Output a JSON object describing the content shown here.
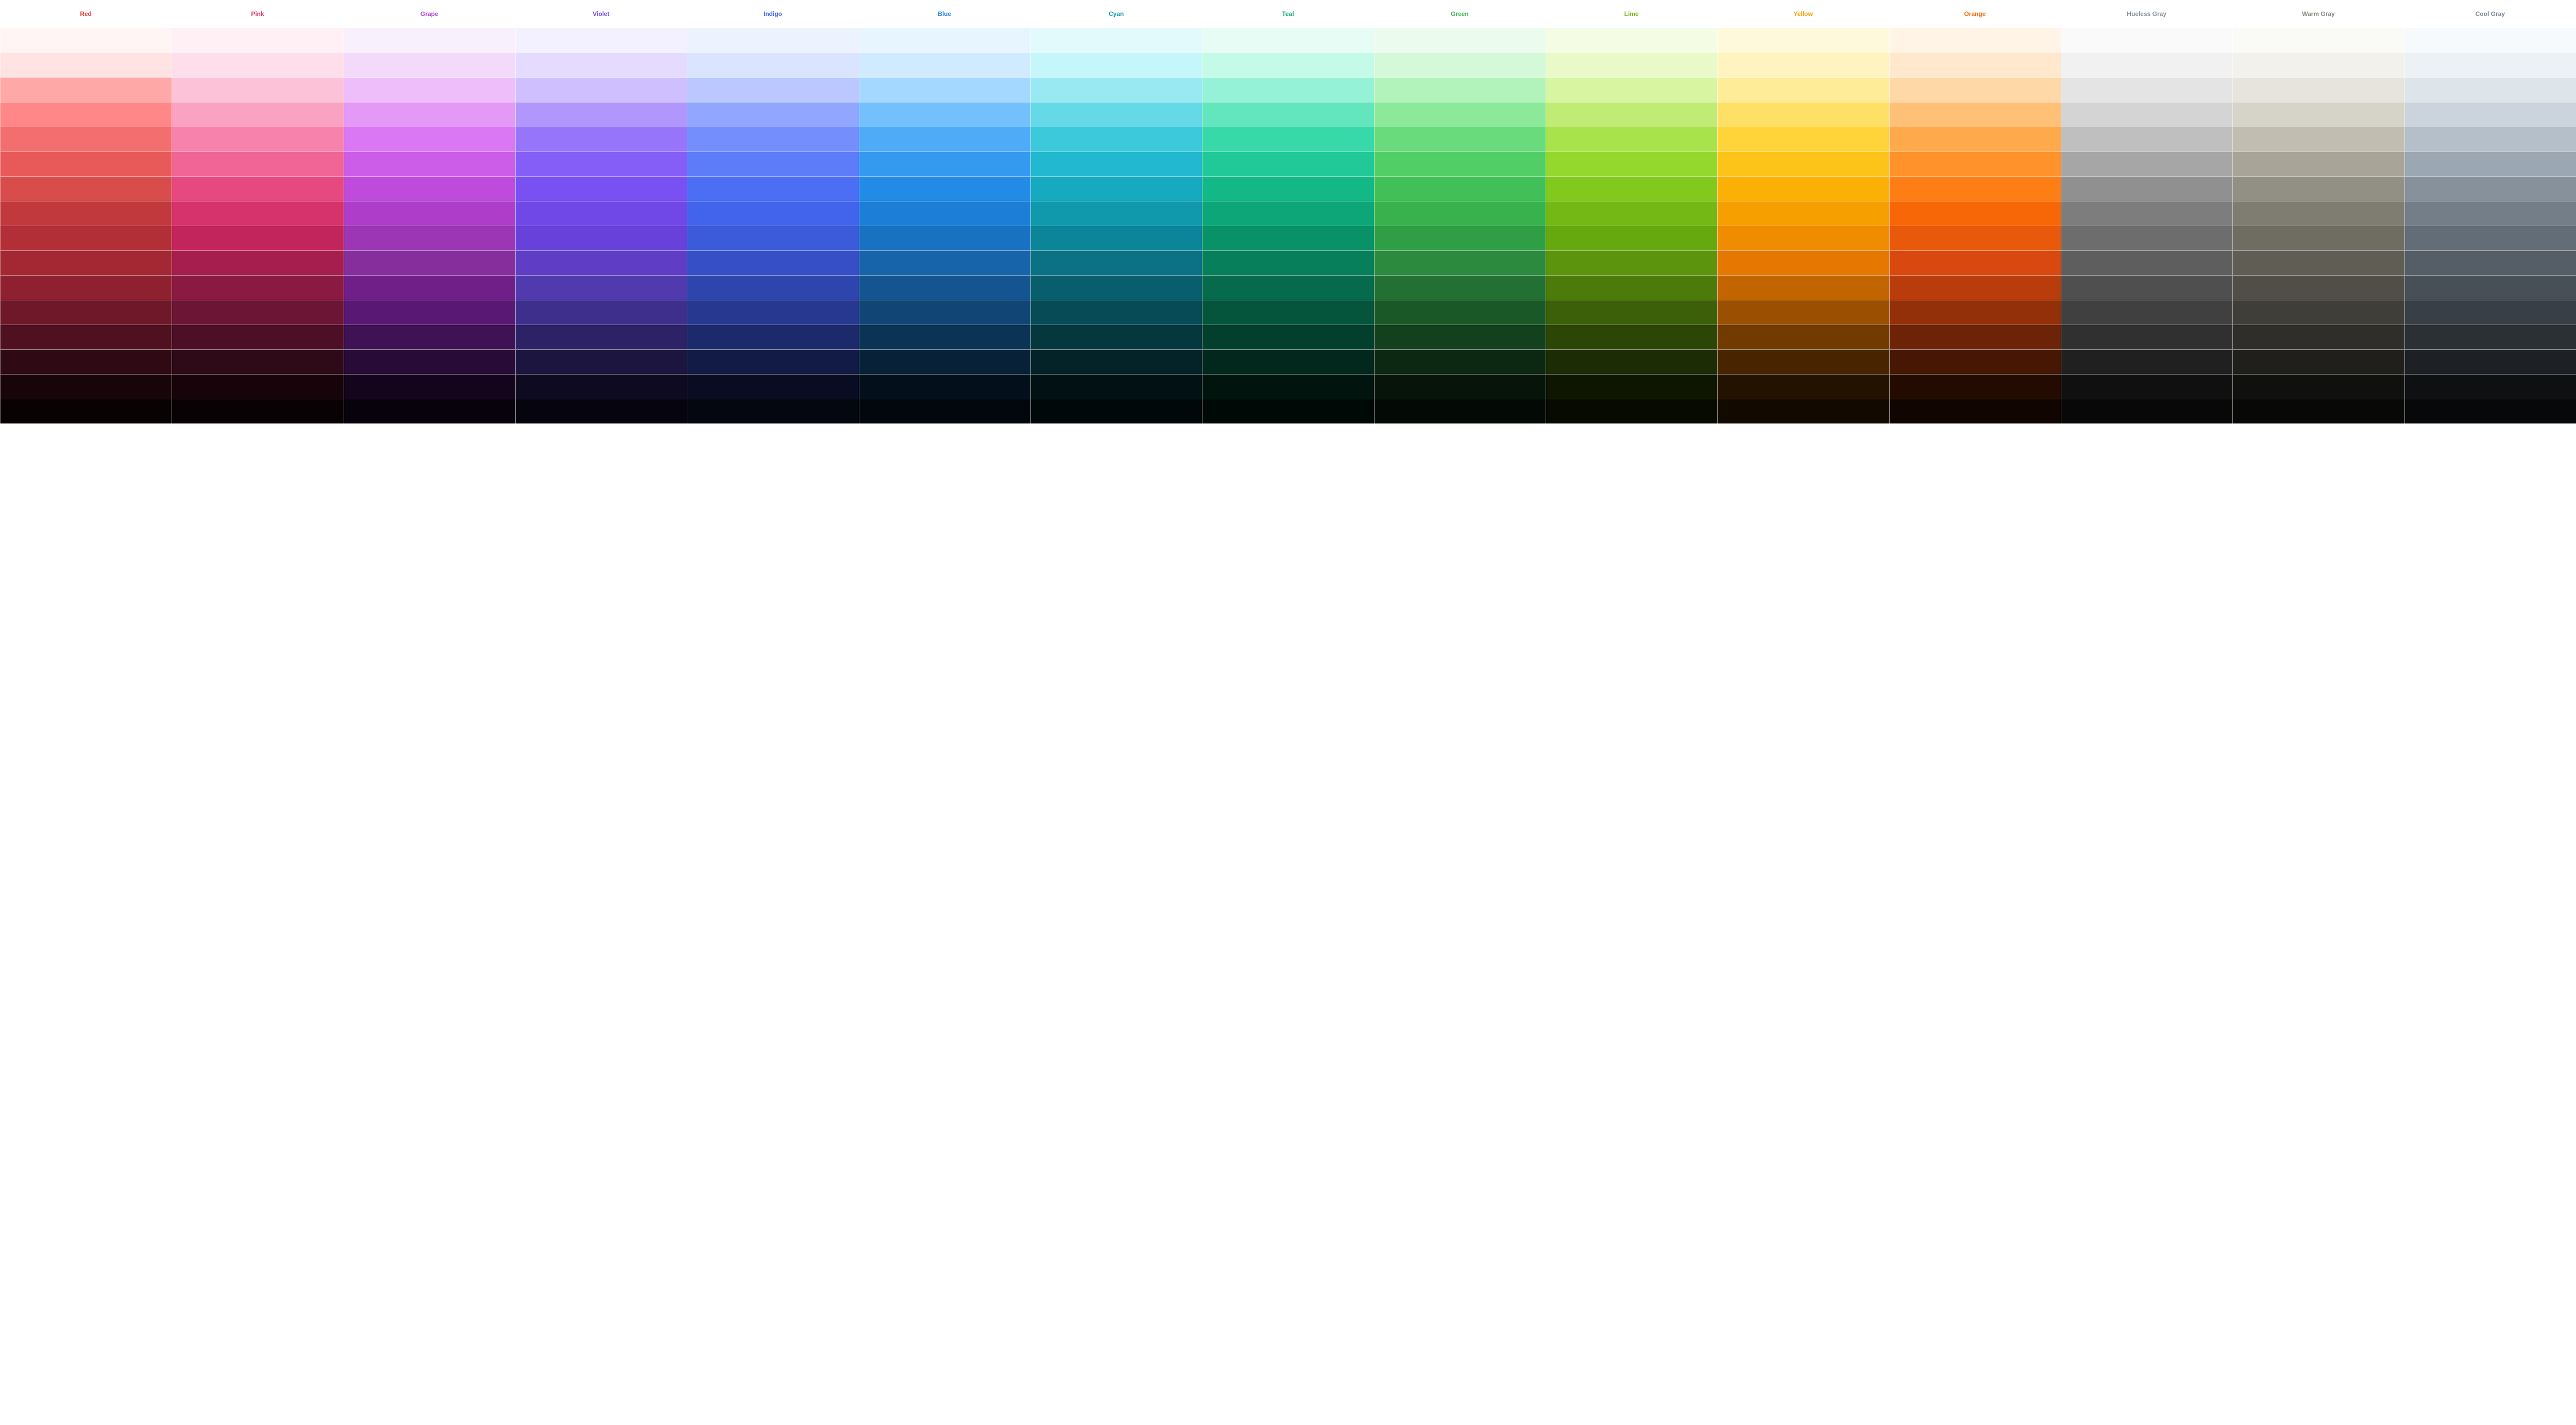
{
  "palette": {
    "columns": [
      {
        "name": "Red",
        "headerColor": "#e03131",
        "swatches": [
          "#fff5f5",
          "#ffe3e3",
          "#ffa8a8",
          "#ff8787",
          "#f36e6e",
          "#e85a5a",
          "#d94c4c",
          "#c1383d",
          "#b32f37",
          "#a42734",
          "#8f2030",
          "#6f182a",
          "#4f1020",
          "#2f0a14",
          "#18050a",
          "#080203"
        ]
      },
      {
        "name": "Pink",
        "headerColor": "#d6336c",
        "swatches": [
          "#fff0f6",
          "#ffdeeb",
          "#fcc2d7",
          "#faa2c1",
          "#f783ac",
          "#f06595",
          "#e64980",
          "#d6336c",
          "#c2255c",
          "#a61e4d",
          "#8a1a42",
          "#6c1535",
          "#4c0f26",
          "#2e0917",
          "#17040b",
          "#080204"
        ]
      },
      {
        "name": "Grape",
        "headerColor": "#ae3ec9",
        "swatches": [
          "#f8f0fc",
          "#f3d9fa",
          "#eebefa",
          "#e599f7",
          "#da77f2",
          "#cc5de8",
          "#be4bdb",
          "#ae3ec9",
          "#9c36b5",
          "#862e9c",
          "#701f89",
          "#581873",
          "#3f1155",
          "#280b37",
          "#14051c",
          "#08020c"
        ]
      },
      {
        "name": "Violet",
        "headerColor": "#7048e8",
        "swatches": [
          "#f3f0ff",
          "#e5dbff",
          "#d0bfff",
          "#b197fc",
          "#9775fa",
          "#845ef7",
          "#7950f2",
          "#7048e8",
          "#6741d9",
          "#5f3dc4",
          "#513aad",
          "#3f2f8c",
          "#2d2266",
          "#1c1540",
          "#0e0a20",
          "#06040e"
        ]
      },
      {
        "name": "Indigo",
        "headerColor": "#4263eb",
        "swatches": [
          "#edf2ff",
          "#dbe4ff",
          "#bac8ff",
          "#91a7ff",
          "#748ffc",
          "#5c7cfa",
          "#4c6ef5",
          "#4263eb",
          "#3b5bdb",
          "#364fc7",
          "#2f45ae",
          "#263890",
          "#1c2a6c",
          "#121b46",
          "#090d23",
          "#040610"
        ]
      },
      {
        "name": "Blue",
        "headerColor": "#1c7ed6",
        "swatches": [
          "#e7f5ff",
          "#d0ebff",
          "#a5d8ff",
          "#74c0fc",
          "#4dabf7",
          "#339af0",
          "#228be6",
          "#1c7ed6",
          "#1971c2",
          "#1864ab",
          "#145591",
          "#104575",
          "#0b3356",
          "#072138",
          "#03101c",
          "#01070d"
        ]
      },
      {
        "name": "Cyan",
        "headerColor": "#1098ad",
        "swatches": [
          "#e3fafc",
          "#c5f6fa",
          "#99e9f2",
          "#66d9e8",
          "#3bc9db",
          "#22b8cf",
          "#15aabf",
          "#1098ad",
          "#0c8599",
          "#0b7285",
          "#095e6e",
          "#074b57",
          "#05373f",
          "#032328",
          "#021214",
          "#010809"
        ]
      },
      {
        "name": "Teal",
        "headerColor": "#0ca678",
        "swatches": [
          "#e6fcf5",
          "#c3fae8",
          "#96f2d7",
          "#63e6be",
          "#38d9a9",
          "#20c997",
          "#12b886",
          "#0ca678",
          "#099268",
          "#087f5b",
          "#066a4c",
          "#05553d",
          "#033f2d",
          "#02281d",
          "#01140e",
          "#010907"
        ]
      },
      {
        "name": "Green",
        "headerColor": "#37b24d",
        "swatches": [
          "#ebfbee",
          "#d3f9d8",
          "#b2f2bb",
          "#8ce99a",
          "#69db7c",
          "#51cf66",
          "#40c057",
          "#37b24d",
          "#2f9e44",
          "#2b8a3e",
          "#237033",
          "#1b5828",
          "#13401d",
          "#0c2812",
          "#061409",
          "#030904"
        ]
      },
      {
        "name": "Lime",
        "headerColor": "#74b816",
        "swatches": [
          "#f4fce3",
          "#e9fac8",
          "#d8f5a2",
          "#c0eb75",
          "#a9e34b",
          "#94d82d",
          "#82c91e",
          "#74b816",
          "#66a80f",
          "#5c940d",
          "#4c7a0b",
          "#3c6009",
          "#2c4606",
          "#1c2c04",
          "#0e1602",
          "#060a01"
        ]
      },
      {
        "name": "Yellow",
        "headerColor": "#f59f00",
        "swatches": [
          "#fff9db",
          "#fff3bf",
          "#ffec99",
          "#ffe066",
          "#ffd43b",
          "#fcc419",
          "#fab005",
          "#f59f00",
          "#f08c00",
          "#e67700",
          "#c26500",
          "#9a5000",
          "#713b00",
          "#482500",
          "#241200",
          "#120900"
        ]
      },
      {
        "name": "Orange",
        "headerColor": "#f76707",
        "swatches": [
          "#fff4e6",
          "#ffe8cc",
          "#ffd8a8",
          "#ffc078",
          "#ffa94d",
          "#ff922b",
          "#fd7e14",
          "#f76707",
          "#e8590c",
          "#d9480f",
          "#b93c0c",
          "#93300a",
          "#6d2307",
          "#471704",
          "#230b02",
          "#110501"
        ]
      },
      {
        "name": "Hueless Gray",
        "headerColor": "#868e96",
        "swatches": [
          "#fafafa",
          "#f1f1f1",
          "#e4e4e4",
          "#d4d4d4",
          "#bfbfbf",
          "#a6a6a6",
          "#909090",
          "#7d7d7d",
          "#6d6d6d",
          "#5e5e5e",
          "#4f4f4f",
          "#404040",
          "#303030",
          "#202020",
          "#101010",
          "#080808"
        ]
      },
      {
        "name": "Warm Gray",
        "headerColor": "#8a8780",
        "swatches": [
          "#fafaf7",
          "#f2f1ec",
          "#e6e4dc",
          "#d6d3c8",
          "#c1beb1",
          "#a8a598",
          "#929084",
          "#7f7c71",
          "#6f6c62",
          "#605d54",
          "#504e46",
          "#403e38",
          "#302e2a",
          "#201f1c",
          "#10100e",
          "#080807"
        ]
      },
      {
        "name": "Cool Gray",
        "headerColor": "#7b8794",
        "swatches": [
          "#f7fafc",
          "#ecf1f5",
          "#dde4ea",
          "#cbd4dc",
          "#b4bfc9",
          "#9ba7b2",
          "#86919c",
          "#737e89",
          "#636d77",
          "#555e67",
          "#474f57",
          "#393f46",
          "#2b3035",
          "#1d2024",
          "#0e1012",
          "#070809"
        ]
      }
    ]
  }
}
